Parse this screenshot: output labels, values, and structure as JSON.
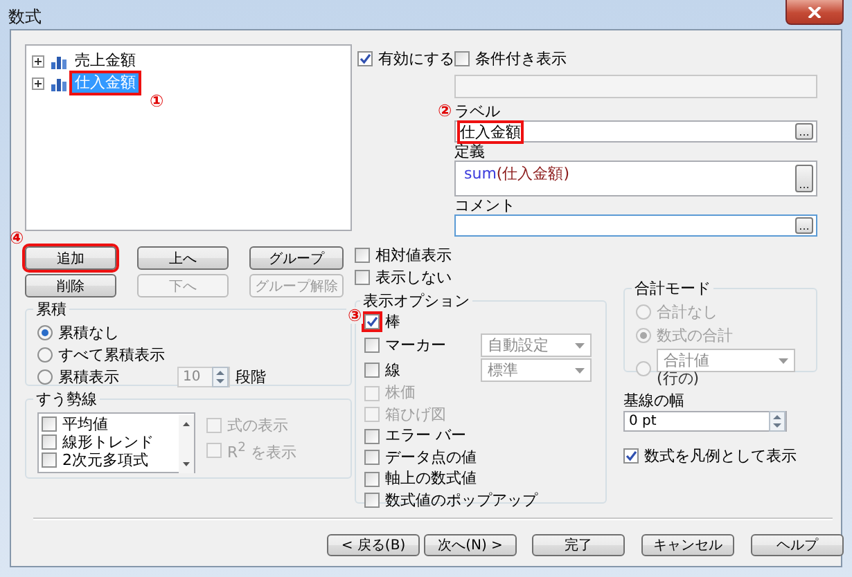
{
  "window": {
    "title": "数式"
  },
  "tree": {
    "items": [
      {
        "label": "売上金額",
        "selected": false,
        "expanded": false
      },
      {
        "label": "仕入金額",
        "selected": true,
        "expanded": false,
        "annotation": "①"
      }
    ]
  },
  "list_buttons": [
    {
      "label": "追加",
      "disabled": false,
      "annotation": "④"
    },
    {
      "label": "上へ",
      "disabled": false
    },
    {
      "label": "グループ",
      "disabled": false
    },
    {
      "label": "削除",
      "disabled": false
    },
    {
      "label": "下へ",
      "disabled": true
    },
    {
      "label": "グループ解除",
      "disabled": true
    }
  ],
  "accumulation": {
    "title": "累積",
    "options": [
      {
        "label": "累積なし",
        "selected": true
      },
      {
        "label": "すべて累積表示",
        "selected": false
      },
      {
        "label": "累積表示",
        "selected": false
      }
    ],
    "steps": {
      "value": "10",
      "disabled": true
    },
    "steps_label": "段階"
  },
  "trendlines": {
    "title": "すう勢線",
    "items": [
      {
        "label": "平均値",
        "checked": false
      },
      {
        "label": "線形トレンド",
        "checked": false
      },
      {
        "label": "2次元多項式",
        "checked": false
      }
    ],
    "options": [
      {
        "label": "式の表示",
        "checked": false,
        "disabled": true
      },
      {
        "label": "R$^{2}$ を表示",
        "checked": false,
        "disabled": true
      }
    ]
  },
  "enable": {
    "label": "有効にする",
    "checked": true
  },
  "conditional": {
    "label": "条件付き表示",
    "checked": false
  },
  "label_field": {
    "label": "ラベル",
    "value": "仕入金額",
    "annotation": "②",
    "browse_button": "..."
  },
  "definition": {
    "label": "定義",
    "tokens": [
      {
        "text": "sum",
        "kind": "function"
      },
      {
        "text": "(仕入金額)",
        "kind": "argument"
      }
    ],
    "browse_button": "..."
  },
  "comment": {
    "label": "コメント",
    "browse_button": "..."
  },
  "series_options": [
    {
      "label": "相対値表示",
      "checked": false
    },
    {
      "label": "表示しない",
      "checked": false
    }
  ],
  "display_options": {
    "title": "表示オプション",
    "items": [
      {
        "kind": "check",
        "label": "棒",
        "checked": true,
        "disabled": false,
        "annotation": "③"
      },
      {
        "kind": "dropdown",
        "label": "マーカー",
        "checked": false,
        "disabled": false,
        "value": "自動設定"
      },
      {
        "kind": "dropdown",
        "label": "線",
        "checked": false,
        "disabled": false,
        "value": "標準"
      },
      {
        "kind": "check",
        "label": "株価",
        "checked": false,
        "disabled": true
      },
      {
        "kind": "check",
        "label": "箱ひげ図",
        "checked": false,
        "disabled": true
      },
      {
        "kind": "check",
        "label": "エラー バー",
        "checked": false,
        "disabled": false
      },
      {
        "kind": "check",
        "label": "データ点の値",
        "checked": false,
        "disabled": false
      },
      {
        "kind": "check",
        "label": "軸上の数式値",
        "checked": false,
        "disabled": false
      },
      {
        "kind": "check",
        "label": "数式値のポップアップ",
        "checked": false,
        "disabled": false
      }
    ]
  },
  "total_mode": {
    "title": "合計モード",
    "disabled": true,
    "options": [
      {
        "kind": "radio",
        "label": "合計なし",
        "selected": false
      },
      {
        "kind": "radio",
        "label": "数式の合計",
        "selected": true
      },
      {
        "kind": "dropdown",
        "value": "合計値",
        "selected": false
      }
    ],
    "row_label": "(行の)"
  },
  "baseline": {
    "label": "基線の幅",
    "value": "0 pt"
  },
  "legend": {
    "label": "数式を凡例として表示",
    "checked": true
  },
  "footer_buttons": [
    "< 戻る(B)",
    "次へ(N) >",
    "完了",
    "キャンセル",
    "ヘルプ"
  ]
}
